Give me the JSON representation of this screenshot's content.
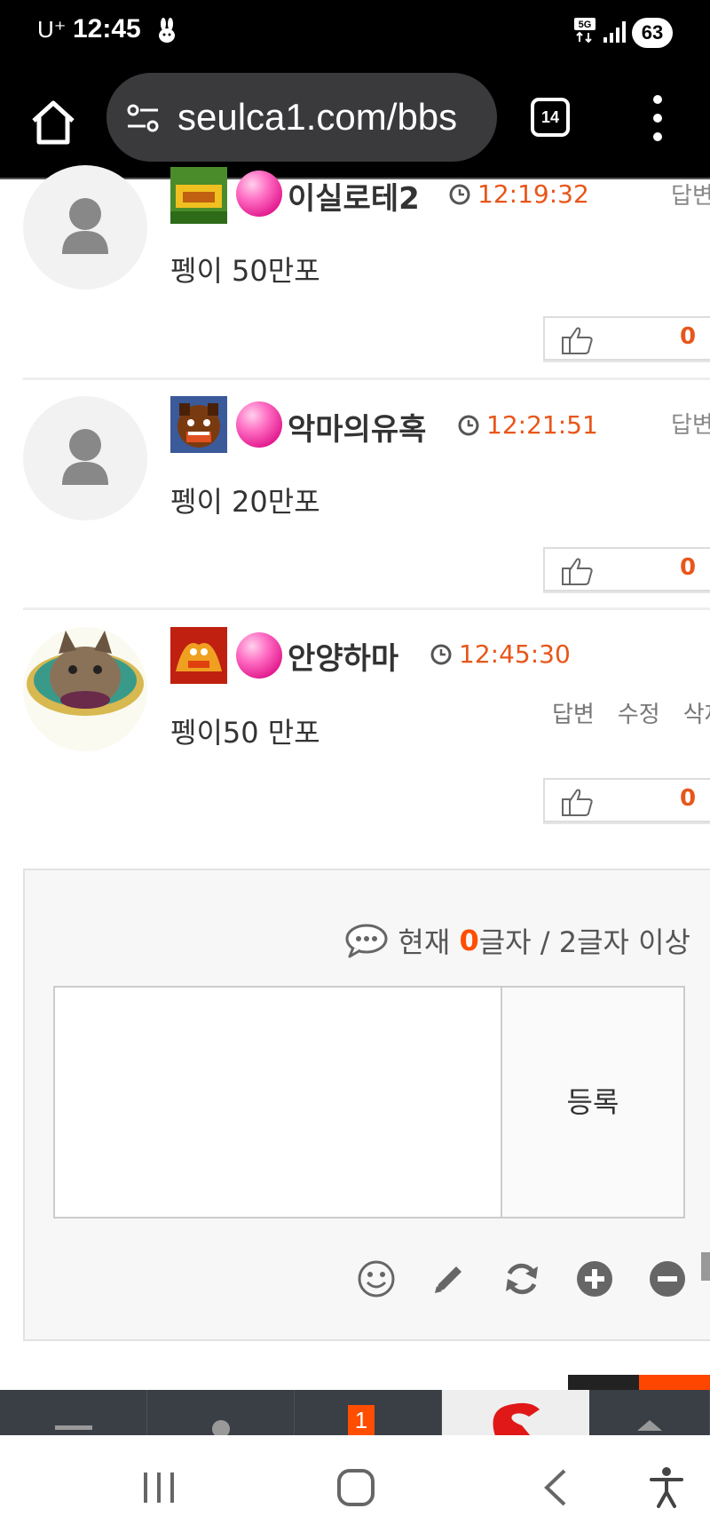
{
  "status_bar": {
    "carrier": "U⁺",
    "time": "12:45",
    "network": "5G",
    "battery": "63"
  },
  "browser": {
    "url": "seulca1.com/bbs",
    "tab_count": "14"
  },
  "comments": [
    {
      "nickname": "이실로테2",
      "time": "12:19:32",
      "text": "펭이 50만포",
      "reply_partial": "답변",
      "likes": "0"
    },
    {
      "nickname": "악마의유혹",
      "time": "12:21:51",
      "text": "펭이 20만포",
      "reply_partial": "답변",
      "likes": "0"
    },
    {
      "nickname": "안양하마",
      "time": "12:45:30",
      "text": "펭이50 만포",
      "actions": [
        "답변",
        "수정",
        "삭제"
      ],
      "likes": "0"
    }
  ],
  "comment_form": {
    "counter_prefix": "현재",
    "counter_value": "0",
    "counter_suffix": "글자 / 2글자 이상",
    "submit_label": "등록",
    "textarea_value": ""
  },
  "site_bar": {
    "badge": "1"
  },
  "colors": {
    "accent": "#e8561a",
    "counter_accent": "#ff4e00"
  }
}
